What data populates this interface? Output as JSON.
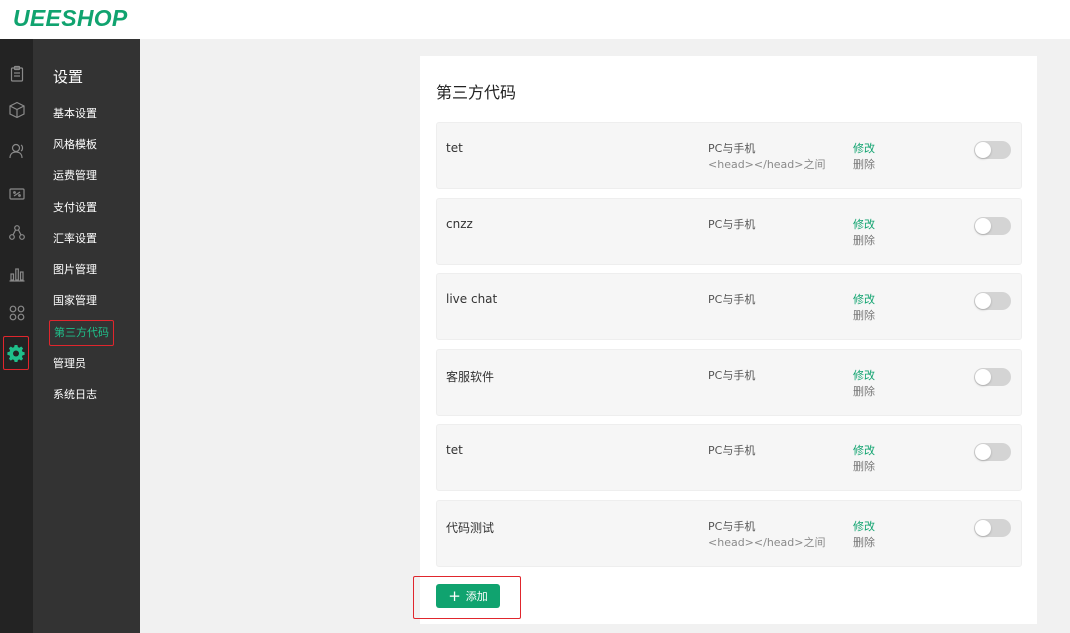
{
  "logo": "UEESHOP",
  "rail": [
    "orders-icon",
    "products-icon",
    "users-icon",
    "coupons-icon",
    "apps-icon",
    "stats-icon",
    "plugins-icon",
    "settings-icon"
  ],
  "menu": {
    "title": "设置",
    "items": [
      "基本设置",
      "风格模板",
      "运费管理",
      "支付设置",
      "汇率设置",
      "图片管理",
      "国家管理",
      "第三方代码",
      "管理员",
      "系统日志"
    ],
    "active_index": 7
  },
  "panel": {
    "title": "第三方代码",
    "edit_label": "修改",
    "delete_label": "删除",
    "rows": [
      {
        "name": "tet",
        "platform": "PC与手机",
        "position": "<head></head>之间",
        "enabled": false
      },
      {
        "name": "cnzz",
        "platform": "PC与手机",
        "position": "",
        "enabled": false
      },
      {
        "name": "live chat",
        "platform": "PC与手机",
        "position": "",
        "enabled": false
      },
      {
        "name": "客服软件",
        "platform": "PC与手机",
        "position": "",
        "enabled": false
      },
      {
        "name": "tet",
        "platform": "PC与手机",
        "position": "",
        "enabled": false
      },
      {
        "name": "代码测试",
        "platform": "PC与手机",
        "position": "<head></head>之间",
        "enabled": false
      }
    ],
    "add_label": "添加"
  },
  "colors": {
    "brand": "#10a36f",
    "highlight": "#e0262d",
    "rail": "#232323",
    "menu": "#333333"
  }
}
